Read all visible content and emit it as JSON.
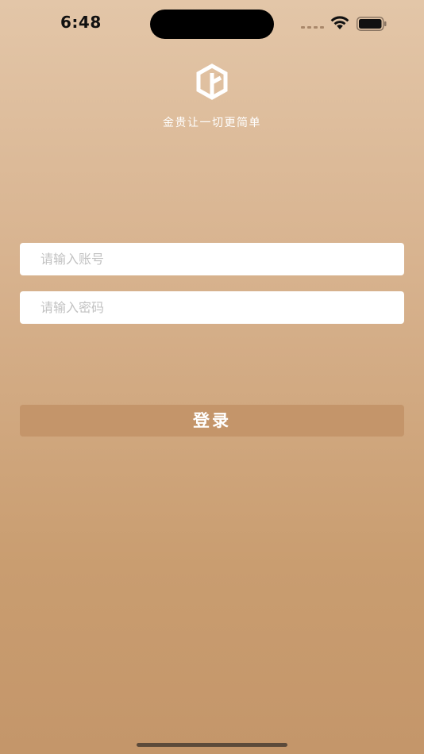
{
  "status_bar": {
    "time": "6:48",
    "icons": [
      "signal-dots-icon",
      "wifi-icon",
      "battery-icon"
    ]
  },
  "brand": {
    "logo_icon": "hexagon-g-logo-icon",
    "tagline": "金贵让一切更简单"
  },
  "form": {
    "account_placeholder": "请输入账号",
    "account_value": "",
    "password_placeholder": "请输入密码",
    "password_value": ""
  },
  "actions": {
    "login_label": "登录"
  },
  "colors": {
    "gradient_top": "#e3c6a8",
    "gradient_bottom": "#c4966a",
    "button": "#c4956a",
    "field_bg": "#ffffff",
    "placeholder": "#c2c2c2"
  }
}
